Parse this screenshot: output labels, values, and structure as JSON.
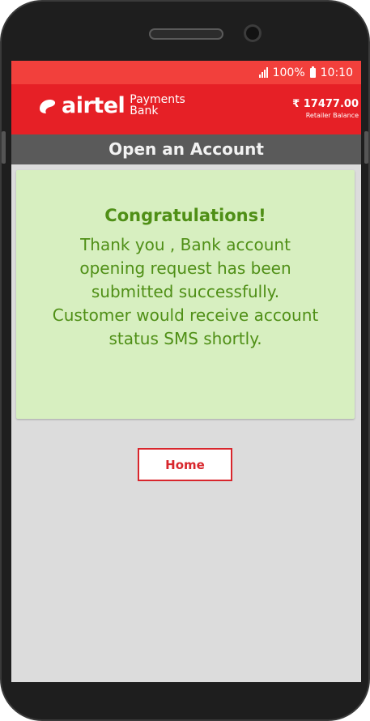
{
  "statusbar": {
    "battery_text": "100%",
    "time": "10:10",
    "bg_color": "#f2403c"
  },
  "appbar": {
    "logo_word": "airtel",
    "logo_line1": "Payments",
    "logo_line2": "Bank",
    "balance_amount": "₹ 17477.00",
    "balance_label": "Retailer Balance",
    "bg_color": "#e62026"
  },
  "titlebar": {
    "title": "Open an Account"
  },
  "confirmation": {
    "heading": "Congratulations!",
    "message": "Thank you , Bank account opening request has been submitted successfully. Customer would receive account status SMS shortly.",
    "bg_color": "#d7efc0",
    "text_color": "#4f8f16"
  },
  "actions": {
    "home_label": "Home"
  },
  "icons": {
    "signal": "signal-icon",
    "battery": "battery-icon",
    "logo": "airtel-logo-icon"
  }
}
